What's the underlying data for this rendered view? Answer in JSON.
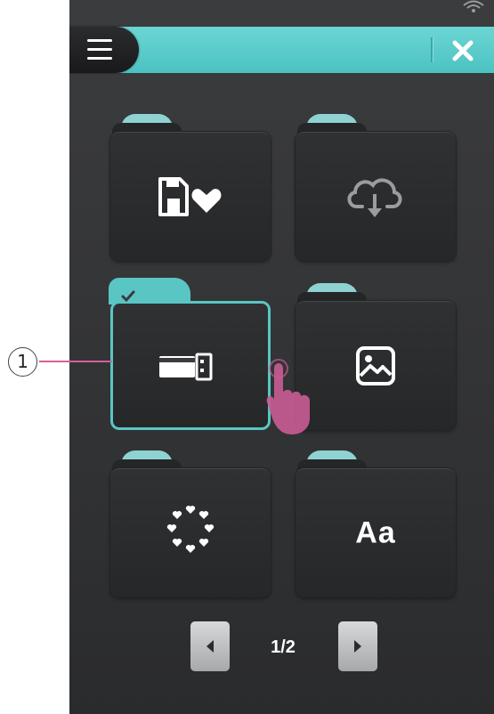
{
  "header": {
    "menu_icon": "hamburger-menu-icon",
    "close_icon": "close-icon",
    "accent_color": "#5cc9c7"
  },
  "folders": [
    {
      "icon": "save-favorite-icon",
      "selected": false
    },
    {
      "icon": "cloud-download-icon",
      "selected": false
    },
    {
      "icon": "usb-memory-icon",
      "selected": true
    },
    {
      "icon": "image-icon",
      "selected": false
    },
    {
      "icon": "heart-circle-pattern-icon",
      "selected": false
    },
    {
      "icon": "text",
      "label": "Aa",
      "selected": false
    }
  ],
  "pager": {
    "page_text": "1/2",
    "prev_icon": "arrow-left-icon",
    "next_icon": "arrow-right-icon"
  },
  "callout": {
    "number": "1",
    "label_text": "①"
  }
}
